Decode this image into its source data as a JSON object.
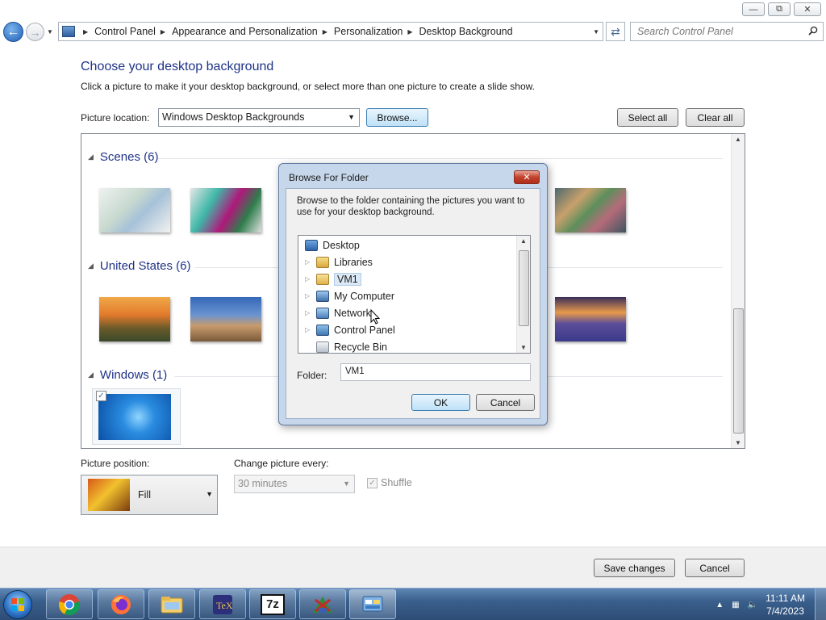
{
  "address": {
    "crumbs": [
      "Control Panel",
      "Appearance and Personalization",
      "Personalization",
      "Desktop Background"
    ],
    "search_placeholder": "Search Control Panel"
  },
  "main": {
    "title": "Choose your desktop background",
    "subtitle": "Click a picture to make it your desktop background, or select more than one picture to create a slide show.",
    "picture_location_label": "Picture location:",
    "picture_location_value": "Windows Desktop Backgrounds",
    "browse_label": "Browse...",
    "select_all_label": "Select all",
    "clear_all_label": "Clear all",
    "groups": [
      {
        "label": "Scenes (6)"
      },
      {
        "label": "United States (6)"
      },
      {
        "label": "Windows (1)"
      }
    ],
    "picture_position_label": "Picture position:",
    "picture_position_value": "Fill",
    "change_every_label": "Change picture every:",
    "change_every_value": "30 minutes",
    "shuffle_label": "Shuffle"
  },
  "footer": {
    "save_label": "Save changes",
    "cancel_label": "Cancel"
  },
  "dialog": {
    "title": "Browse For Folder",
    "description": "Browse to the folder containing the pictures you want to use for your desktop background.",
    "tree": [
      {
        "label": "Desktop",
        "icon": "desktop-icon",
        "expandable": false
      },
      {
        "label": "Libraries",
        "icon": "libraries-icon",
        "expandable": true
      },
      {
        "label": "VM1",
        "icon": "user-folder-icon",
        "expandable": true,
        "selected": true
      },
      {
        "label": "My Computer",
        "icon": "computer-icon",
        "expandable": true
      },
      {
        "label": "Network",
        "icon": "network-icon",
        "expandable": true
      },
      {
        "label": "Control Panel",
        "icon": "control-panel-icon",
        "expandable": true
      },
      {
        "label": "Recycle Bin",
        "icon": "recycle-bin-icon",
        "expandable": false
      }
    ],
    "folder_label": "Folder:",
    "folder_value": "VM1",
    "ok_label": "OK",
    "cancel_label": "Cancel"
  },
  "taskbar": {
    "apps": [
      "chrome-icon",
      "firefox-icon",
      "file-explorer-icon",
      "texstudio-icon",
      "7zip-icon",
      "network-tool-icon",
      "control-panel-icon"
    ],
    "app_labels": {
      "7zip": "7z"
    },
    "time": "11:11 AM",
    "date": "7/4/2023"
  },
  "colors": {
    "heading": "#1e3287",
    "taskbar": "#3a5f8c",
    "dialog_frame": "#c7d7eb",
    "focus_button": "#bfe1f8"
  }
}
